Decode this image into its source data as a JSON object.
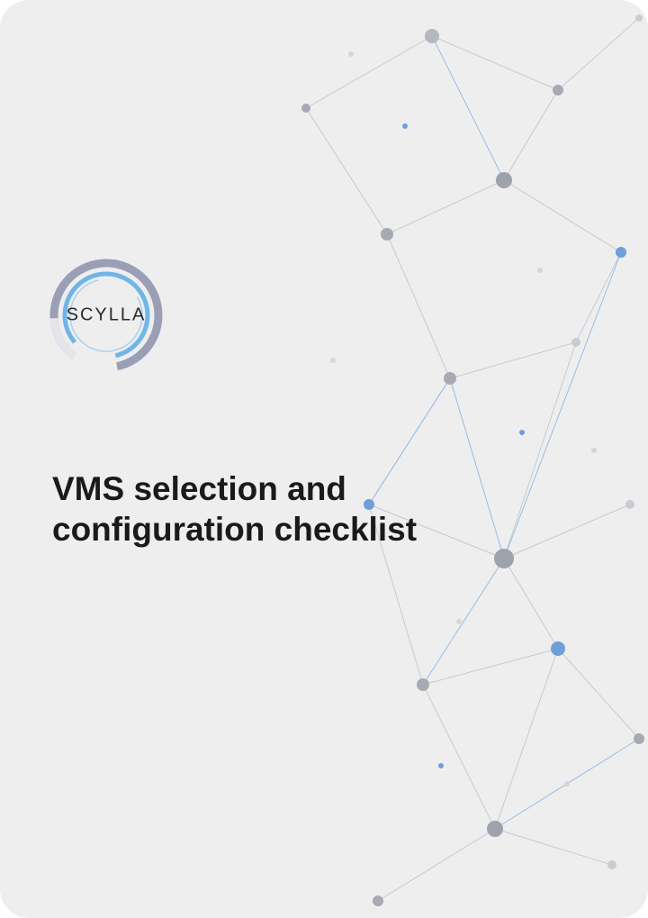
{
  "brand": {
    "name": "SCYLLA",
    "ring_outer_color": "#9b9fb6",
    "ring_inner_color": "#6fb6e6",
    "ring_accent_color": "#d9dbe4"
  },
  "document": {
    "title": "VMS selection and configuration checklist"
  },
  "decoration": {
    "line_color_gray": "#b9bcc4",
    "line_color_blue": "#7faee0",
    "node_color_gray": "#a7aab3",
    "node_color_blue": "#6f9fd8",
    "node_color_light": "#d4d6dc"
  }
}
